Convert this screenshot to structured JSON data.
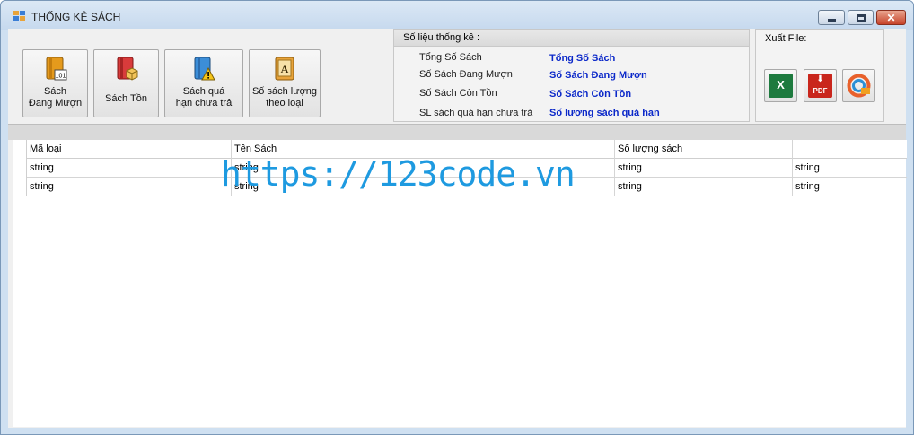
{
  "window": {
    "title": "THỐNG KÊ SÁCH",
    "controls": {
      "minimize": "minimize",
      "maximize": "maximize",
      "close": "✕"
    }
  },
  "toolbar": {
    "buttons": [
      {
        "label": "Sách\nĐang Mượn",
        "icon": "book-101-icon"
      },
      {
        "label": "Sách Tồn",
        "icon": "book-box-icon"
      },
      {
        "label": "Sách quá\nhạn chưa trả",
        "icon": "book-warning-icon"
      },
      {
        "label": "Số sách lượng\ntheo loại",
        "icon": "book-letter-a-icon"
      }
    ]
  },
  "stats": {
    "header": "Số liệu thống kê :",
    "rows": [
      {
        "label": "Tổng Số Sách",
        "value": "Tổng Số Sách"
      },
      {
        "label": "Số Sách Đang Mượn",
        "value": "Số Sách Đang Mượn"
      },
      {
        "label": "Số Sách Còn Tồn",
        "value": "Số Sách Còn Tồn"
      },
      {
        "label": "SL sách quá hạn chưa trả",
        "value": "Số lượng sách quá hạn"
      }
    ]
  },
  "export": {
    "label": "Xuất File:",
    "buttons": [
      {
        "icon": "excel-icon",
        "text": "X"
      },
      {
        "icon": "pdf-icon",
        "text": "PDF"
      },
      {
        "icon": "html-icon",
        "text": ""
      }
    ]
  },
  "grid": {
    "columns": [
      "Mã loại",
      "Tên Sách",
      "Số lượng sách",
      ""
    ],
    "rows": [
      [
        "string",
        "string",
        "string",
        "string"
      ],
      [
        "string",
        "string",
        "string",
        "string"
      ]
    ]
  },
  "watermark": "https://123code.vn",
  "colors": {
    "stat_value": "#0b28c9",
    "watermark": "#1e9ae0",
    "excel": "#1d7a3e",
    "pdf": "#c9261c"
  }
}
